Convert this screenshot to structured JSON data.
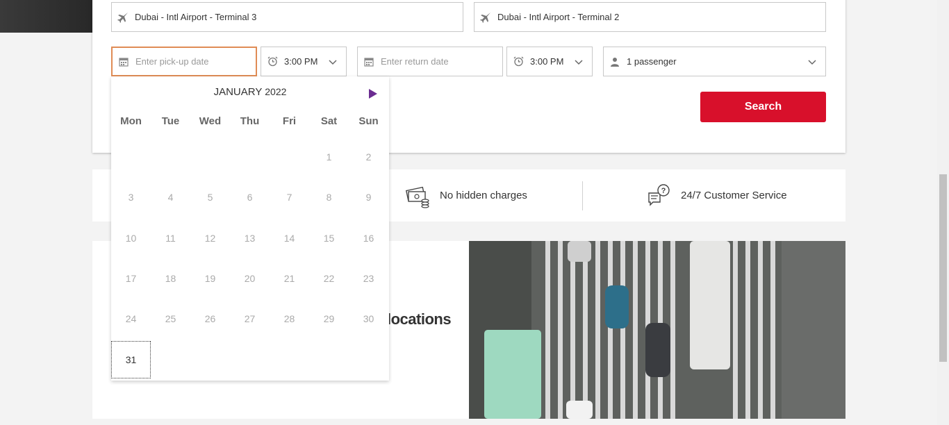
{
  "locations": {
    "pickup_value": "Dubai - Intl Airport - Terminal 3",
    "return_value": "Dubai - Intl Airport - Terminal 2"
  },
  "dates": {
    "pickup_placeholder": "Enter pick-up date",
    "pickup_time": "3:00 PM",
    "return_placeholder": "Enter return date",
    "return_time": "3:00 PM"
  },
  "passengers": {
    "value": "1 passenger"
  },
  "search": {
    "label": "Search"
  },
  "features": [
    {
      "label": "No hidden charges",
      "icon": "money-icon"
    },
    {
      "label": "24/7 Customer Service",
      "icon": "chat-support-icon"
    }
  ],
  "promo": {
    "headline_partial": "locations"
  },
  "calendar": {
    "month": "JANUARY",
    "year": "2022",
    "weekdays": [
      "Mon",
      "Tue",
      "Wed",
      "Thu",
      "Fri",
      "Sat",
      "Sun"
    ],
    "days": [
      "1",
      "2",
      "3",
      "4",
      "5",
      "6",
      "7",
      "8",
      "9",
      "10",
      "11",
      "12",
      "13",
      "14",
      "15",
      "16",
      "17",
      "18",
      "19",
      "20",
      "21",
      "22",
      "23",
      "24",
      "25",
      "26",
      "27",
      "28",
      "29",
      "30",
      "31"
    ],
    "selected_day": "31",
    "accent": "#6b2c91"
  },
  "colors": {
    "primary_button": "#d8102b",
    "focus_border": "#e08c55"
  }
}
